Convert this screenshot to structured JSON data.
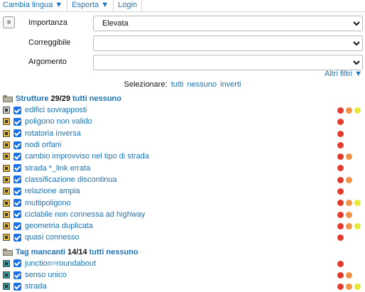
{
  "menu": {
    "items": [
      "Cambia lingua ▼",
      "Esporta ▼",
      "Login"
    ]
  },
  "filters": {
    "menu_icon": "≡",
    "importanza": {
      "label": "Importanza",
      "value": "Elevata"
    },
    "correggibile": {
      "label": "Correggibile",
      "value": ""
    },
    "argomento": {
      "label": "Argomento",
      "value": ""
    },
    "altri": "Altri filtri ▼"
  },
  "select_row": {
    "label": "Selezionare:",
    "all": "tutti",
    "none": "nessuno",
    "invert": "inverti"
  },
  "sections": [
    {
      "title": "Strutture",
      "count": "29/29",
      "all": "tutti",
      "none": "nessuno",
      "items": [
        {
          "label": "edifici sovrapposti",
          "icon": "building-overlap-icon",
          "icon_color": "gray",
          "dots": [
            "r",
            "o",
            "y"
          ]
        },
        {
          "label": "poligono non valido",
          "icon": "invalid-polygon-icon",
          "icon_color": "yellow",
          "dots": [
            "r"
          ]
        },
        {
          "label": "rotatoria inversa",
          "icon": "roundabout-icon",
          "icon_color": "yellow",
          "dots": [
            "r"
          ]
        },
        {
          "label": "nodi orfani",
          "icon": "orphan-node-icon",
          "icon_color": "yellow",
          "dots": [
            "r"
          ]
        },
        {
          "label": "cambio improvviso nel tipo di strada",
          "icon": "road-type-icon",
          "icon_color": "yellow",
          "dots": [
            "r",
            "o"
          ]
        },
        {
          "label": "strada *_link errata",
          "icon": "link-road-icon",
          "icon_color": "yellow",
          "dots": [
            "r"
          ]
        },
        {
          "label": "classificazione discontinua",
          "icon": "classification-icon",
          "icon_color": "yellow",
          "dots": [
            "r",
            "o"
          ]
        },
        {
          "label": "relazione ampia",
          "icon": "relation-icon",
          "icon_color": "yellow",
          "dots": [
            "r"
          ]
        },
        {
          "label": "multipoligono",
          "icon": "multipolygon-icon",
          "icon_color": "yellow",
          "dots": [
            "r",
            "o",
            "y"
          ]
        },
        {
          "label": "ciclabile non connessa ad highway",
          "icon": "cycleway-icon",
          "icon_color": "yellow",
          "dots": [
            "r",
            "o"
          ]
        },
        {
          "label": "geometria duplicata",
          "icon": "duplicate-geometry-icon",
          "icon_color": "yellow",
          "dots": [
            "r",
            "o",
            "y"
          ]
        },
        {
          "label": "quasi connesso",
          "icon": "almost-connected-icon",
          "icon_color": "yellow",
          "dots": [
            "r"
          ]
        }
      ]
    },
    {
      "title": "Tag mancanti",
      "count": "14/14",
      "all": "tutti",
      "none": "nessuno",
      "items": [
        {
          "label": "junction=roundabout",
          "icon": "junction-icon",
          "icon_color": "teal",
          "dots": [
            "r"
          ]
        },
        {
          "label": "senso unico",
          "icon": "oneway-icon",
          "icon_color": "teal",
          "dots": [
            "r",
            "o"
          ]
        },
        {
          "label": "strada",
          "icon": "road-icon",
          "icon_color": "teal",
          "dots": [
            "r",
            "o",
            "y"
          ]
        }
      ]
    }
  ]
}
